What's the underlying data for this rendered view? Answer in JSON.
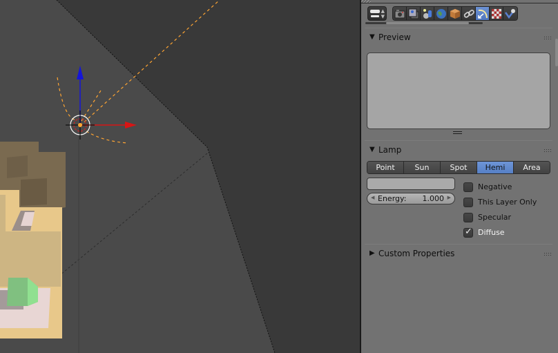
{
  "viewport": {
    "background": "#393939",
    "floor_color": "#4a4a4a",
    "lamp": {
      "type": "hemi",
      "color": "#ffa533"
    },
    "gizmo": {
      "z_axis_color": "#1515d8",
      "x_axis_color": "#d81515"
    },
    "objects": [
      {
        "name": "tan-building",
        "color": "#e8c88a"
      },
      {
        "name": "brown-roof",
        "color": "#7a6a50"
      },
      {
        "name": "green-block",
        "color": "#80d080"
      },
      {
        "name": "pink-base",
        "color": "#e8d6d4"
      }
    ]
  },
  "properties": {
    "header": {
      "context_toggle_icon": "context-toggle-icon",
      "tabs": [
        {
          "name": "render",
          "icon": "camera-icon",
          "active": false
        },
        {
          "name": "render-layers",
          "icon": "render-layers-icon",
          "active": false
        },
        {
          "name": "scene",
          "icon": "scene-icon",
          "active": false
        },
        {
          "name": "world",
          "icon": "world-icon",
          "active": false
        },
        {
          "name": "object",
          "icon": "cube-icon",
          "active": false
        },
        {
          "name": "constraints",
          "icon": "link-icon",
          "active": false
        },
        {
          "name": "lamp-data",
          "icon": "lamp-data-icon",
          "active": true
        },
        {
          "name": "texture",
          "icon": "checker-texture-icon",
          "active": false
        },
        {
          "name": "physics",
          "icon": "physics-icon",
          "active": false
        }
      ]
    },
    "panels": {
      "preview": {
        "title": "Preview",
        "expanded": true
      },
      "lamp": {
        "title": "Lamp",
        "expanded": true,
        "types": [
          "Point",
          "Sun",
          "Spot",
          "Hemi",
          "Area"
        ],
        "selected_type": "Hemi",
        "color_value": "#aaaaaa",
        "energy_label": "Energy:",
        "energy_value": "1.000",
        "checkboxes": [
          {
            "label": "Negative",
            "checked": false
          },
          {
            "label": "This Layer Only",
            "checked": false
          },
          {
            "label": "Specular",
            "checked": false
          },
          {
            "label": "Diffuse",
            "checked": true
          }
        ]
      },
      "custom_properties": {
        "title": "Custom Properties",
        "expanded": false
      }
    },
    "accent_color": "#5680c6"
  }
}
